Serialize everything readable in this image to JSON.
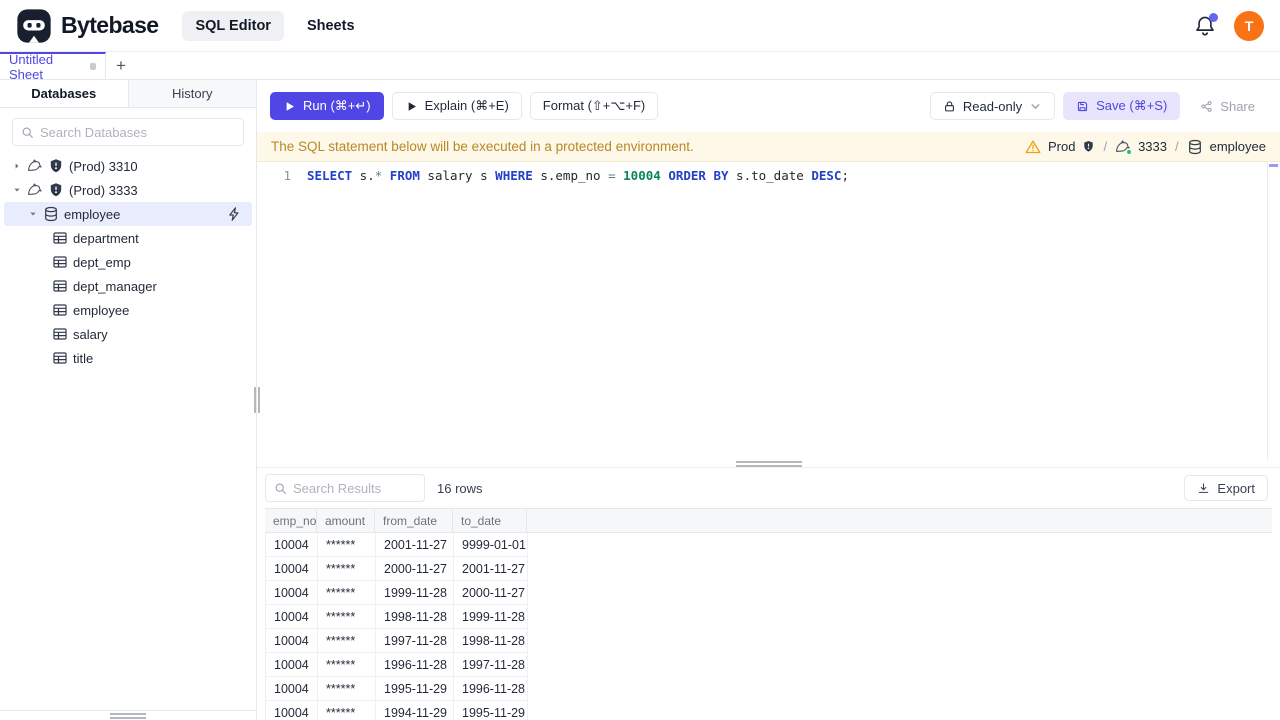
{
  "colors": {
    "accent": "#4f46e5",
    "accent_soft": "#e7e4fb",
    "selected_row": "#e9ecfc",
    "banner_bg": "#fdf8e7",
    "banner_text": "#b8882a",
    "warning": "#f59e0b",
    "avatar_bg": "#f97316",
    "notification_dot": "#6366f1",
    "kw": "#2540c8",
    "num": "#098658",
    "op": "#4f8391",
    "green_status": "#22c55e"
  },
  "header": {
    "brand": "Bytebase",
    "nav": [
      {
        "label": "SQL Editor",
        "active": true
      },
      {
        "label": "Sheets",
        "active": false
      }
    ],
    "avatar_initial": "T"
  },
  "sheet_tabs": {
    "items": [
      {
        "label": "Untitled Sheet",
        "active": true,
        "dirty": true
      }
    ],
    "add_label": "+"
  },
  "sidebar": {
    "tabs": [
      {
        "label": "Databases",
        "active": true
      },
      {
        "label": "History",
        "active": false
      }
    ],
    "search_placeholder": "Search Databases",
    "tree": [
      {
        "kind": "instance",
        "label": "(Prod) 3310",
        "expanded": false,
        "level": 0
      },
      {
        "kind": "instance",
        "label": "(Prod) 3333",
        "expanded": true,
        "level": 0
      },
      {
        "kind": "database",
        "label": "employee",
        "expanded": true,
        "selected": true,
        "level": 1
      },
      {
        "kind": "table",
        "label": "department",
        "level": 2
      },
      {
        "kind": "table",
        "label": "dept_emp",
        "level": 2
      },
      {
        "kind": "table",
        "label": "dept_manager",
        "level": 2
      },
      {
        "kind": "table",
        "label": "employee",
        "level": 2
      },
      {
        "kind": "table",
        "label": "salary",
        "level": 2
      },
      {
        "kind": "table",
        "label": "title",
        "level": 2
      }
    ]
  },
  "toolbar": {
    "run_label": "Run (⌘+↵)",
    "explain_label": "Explain (⌘+E)",
    "format_label": "Format (⇧+⌥+F)",
    "readonly_label": "Read-only",
    "save_label": "Save (⌘+S)",
    "share_label": "Share"
  },
  "banner": {
    "message": "The SQL statement below will be executed in a protected environment.",
    "environment": "Prod",
    "instance": "3333",
    "database": "employee",
    "separator": "/"
  },
  "sql": {
    "line_number": "1",
    "statement": "SELECT s.* FROM salary s WHERE s.emp_no = 10004 ORDER BY s.to_date DESC;",
    "tokens": [
      {
        "text": "SELECT",
        "type": "keyword"
      },
      {
        "text": " s.",
        "type": "plain"
      },
      {
        "text": "*",
        "type": "operator"
      },
      {
        "text": " ",
        "type": "plain"
      },
      {
        "text": "FROM",
        "type": "keyword"
      },
      {
        "text": " salary s ",
        "type": "plain"
      },
      {
        "text": "WHERE",
        "type": "keyword"
      },
      {
        "text": " s.emp_no ",
        "type": "plain"
      },
      {
        "text": "=",
        "type": "operator"
      },
      {
        "text": " ",
        "type": "plain"
      },
      {
        "text": "10004",
        "type": "number"
      },
      {
        "text": " ",
        "type": "plain"
      },
      {
        "text": "ORDER BY",
        "type": "keyword"
      },
      {
        "text": " s.to_date ",
        "type": "plain"
      },
      {
        "text": "DESC",
        "type": "keyword"
      },
      {
        "text": ";",
        "type": "plain"
      }
    ]
  },
  "results": {
    "search_placeholder": "Search Results",
    "row_count": "16 rows",
    "export_label": "Export",
    "columns": [
      "emp_no",
      "amount",
      "from_date",
      "to_date"
    ],
    "rows": [
      [
        "10004",
        "******",
        "2001-11-27",
        "9999-01-01"
      ],
      [
        "10004",
        "******",
        "2000-11-27",
        "2001-11-27"
      ],
      [
        "10004",
        "******",
        "1999-11-28",
        "2000-11-27"
      ],
      [
        "10004",
        "******",
        "1998-11-28",
        "1999-11-28"
      ],
      [
        "10004",
        "******",
        "1997-11-28",
        "1998-11-28"
      ],
      [
        "10004",
        "******",
        "1996-11-28",
        "1997-11-28"
      ],
      [
        "10004",
        "******",
        "1995-11-29",
        "1996-11-28"
      ],
      [
        "10004",
        "******",
        "1994-11-29",
        "1995-11-29"
      ]
    ]
  }
}
